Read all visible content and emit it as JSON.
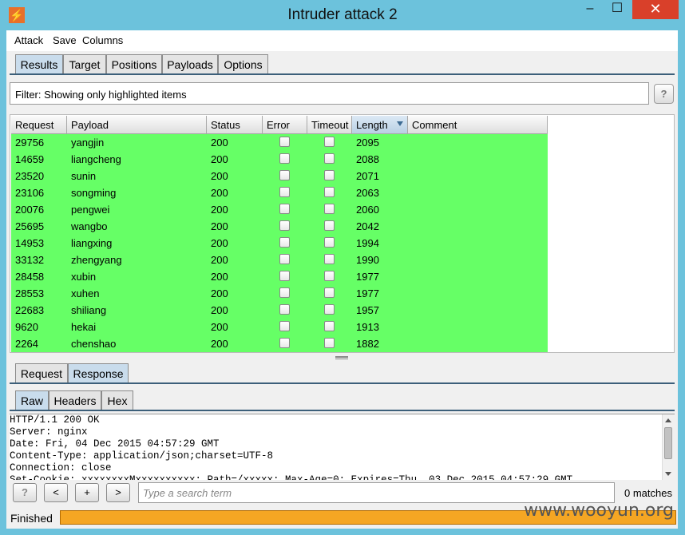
{
  "window": {
    "title": "Intruder attack 2"
  },
  "menu": {
    "items": [
      "Attack",
      "Save",
      "Columns"
    ]
  },
  "main_tabs": {
    "labels": [
      "Results",
      "Target",
      "Positions",
      "Payloads",
      "Options"
    ],
    "active": "Results"
  },
  "filter": {
    "text": "Filter: Showing only highlighted items",
    "help_label": "?"
  },
  "table": {
    "columns": [
      "Request",
      "Payload",
      "Status",
      "Error",
      "Timeout",
      "Length",
      "Comment"
    ],
    "sorted_column": "Length",
    "highlight_color": "#66ff66",
    "rows": [
      {
        "request": "29756",
        "payload": "yangjin",
        "status": "200",
        "length": "2095"
      },
      {
        "request": "14659",
        "payload": "liangcheng",
        "status": "200",
        "length": "2088"
      },
      {
        "request": "23520",
        "payload": "sunin",
        "status": "200",
        "length": "2071"
      },
      {
        "request": "23106",
        "payload": "songming",
        "status": "200",
        "length": "2063"
      },
      {
        "request": "20076",
        "payload": "pengwei",
        "status": "200",
        "length": "2060"
      },
      {
        "request": "25695",
        "payload": "wangbo",
        "status": "200",
        "length": "2042"
      },
      {
        "request": "14953",
        "payload": "liangxing",
        "status": "200",
        "length": "1994"
      },
      {
        "request": "33132",
        "payload": "zhengyang",
        "status": "200",
        "length": "1990"
      },
      {
        "request": "28458",
        "payload": "xubin",
        "status": "200",
        "length": "1977"
      },
      {
        "request": "28553",
        "payload": "xuhen",
        "status": "200",
        "length": "1977"
      },
      {
        "request": "22683",
        "payload": "shiliang",
        "status": "200",
        "length": "1957"
      },
      {
        "request": "9620",
        "payload": "hekai",
        "status": "200",
        "length": "1913"
      },
      {
        "request": "2264",
        "payload": "chenshao",
        "status": "200",
        "length": "1882"
      }
    ]
  },
  "req_resp_tabs": {
    "labels": [
      "Request",
      "Response"
    ],
    "active": "Response"
  },
  "view_tabs": {
    "labels": [
      "Raw",
      "Headers",
      "Hex"
    ],
    "active": "Raw"
  },
  "response_text": "HTTP/1.1 200 OK\nServer: nginx\nDate: Fri, 04 Dec 2015 04:57:29 GMT\nContent-Type: application/json;charset=UTF-8\nConnection: close\nSet-Cookie: xxxxxxxxMxxxxxxxxxx: Path=/xxxxx; Max-Age=0; Expires=Thu, 03 Dec 2015 04:57:29 GMT",
  "search": {
    "placeholder": "Type a search term",
    "matches": "0 matches",
    "buttons": [
      "?",
      "<",
      "+",
      ">"
    ]
  },
  "status": {
    "text": "Finished",
    "progress": 1.0,
    "progress_color": "#f5a623"
  },
  "watermark": "www.wooyun.org"
}
